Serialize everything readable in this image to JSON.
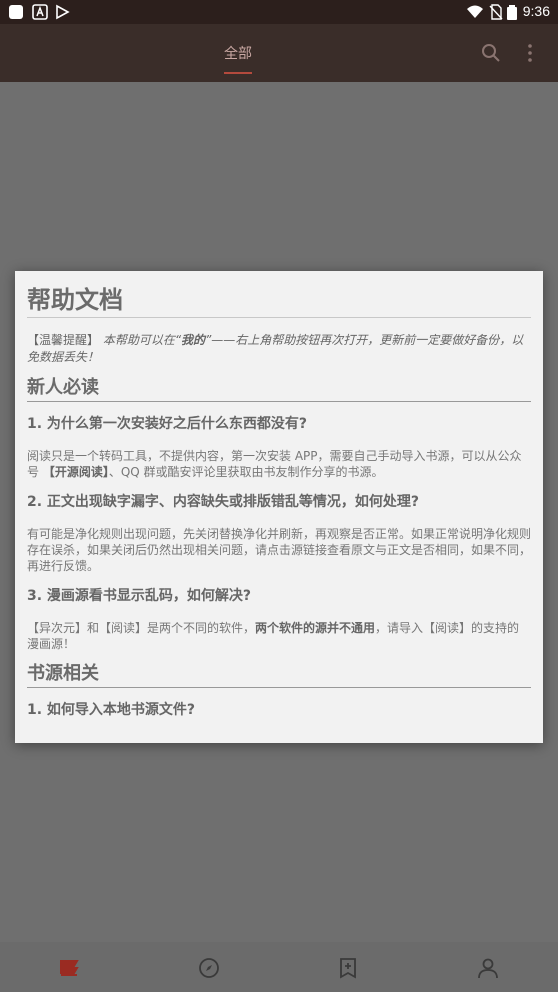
{
  "status_bar": {
    "time": "9:36"
  },
  "app_bar": {
    "tab_label": "全部"
  },
  "dialog": {
    "title": "帮助文档",
    "tip": {
      "prefix": "【温馨提醒】 ",
      "text1": "本帮助可以在“",
      "bold": "我的",
      "text2": "”——右上角帮助按钮再次打开，更新前一定要做好备份，以免数据丢失！"
    },
    "section1": {
      "heading": "新人必读",
      "q1": {
        "question": "1. 为什么第一次安装好之后什么东西都没有?",
        "answer_part1": "阅读只是一个转码工具，不提供内容，第一次安装 APP，需要自己手动导入书源，可以从公众号 ",
        "answer_bold": "【开源阅读】",
        "answer_part2": "、QQ 群或酷安评论里获取由书友制作分享的书源。"
      },
      "q2": {
        "question": "2. 正文出现缺字漏字、内容缺失或排版错乱等情况，如何处理?",
        "answer": "有可能是净化规则出现问题，先关闭替换净化并刷新，再观察是否正常。如果正常说明净化规则存在误杀，如果关闭后仍然出现相关问题，请点击源链接查看原文与正文是否相同，如果不同，再进行反馈。"
      },
      "q3": {
        "question": "3. 漫画源看书显示乱码，如何解决?",
        "answer_part1": "【异次元】和【阅读】是两个不同的软件，",
        "answer_bold": "两个软件的源并不通用",
        "answer_part2": "，请导入【阅读】的支持的漫画源！"
      }
    },
    "section2": {
      "heading": "书源相关",
      "q1": {
        "question": "1. 如何导入本地书源文件?"
      }
    }
  },
  "colors": {
    "accent": "#b44a3d",
    "app_bar": "#3a2d29",
    "status_bar": "#2c1f1c",
    "scrim": "#6f6f6f",
    "dialog_bg": "#f2f2f2"
  },
  "bottom_nav": {
    "items": [
      "bookshelf-icon",
      "discover-icon",
      "rss-icon",
      "my-icon"
    ]
  }
}
